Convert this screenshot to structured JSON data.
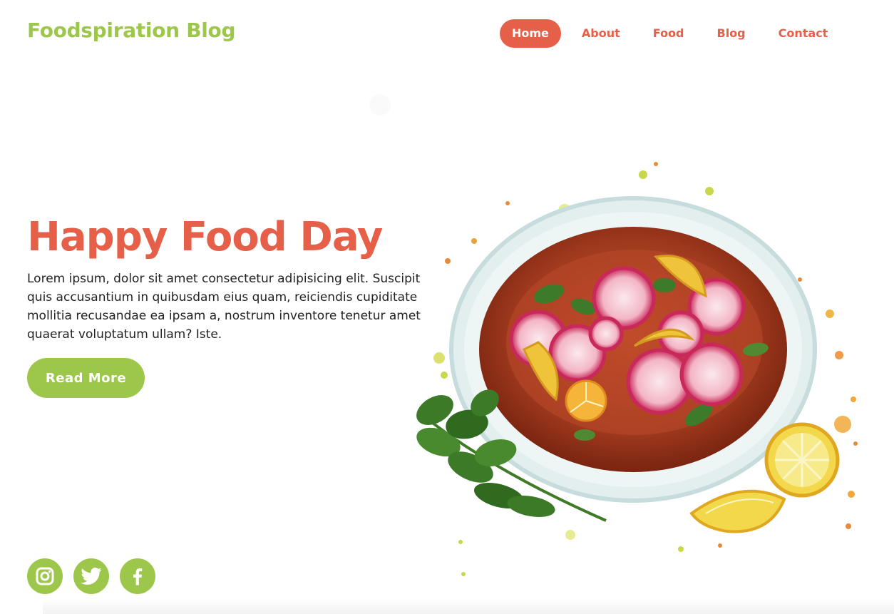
{
  "brand": {
    "name": "Foodspiration Blog"
  },
  "nav": {
    "items": [
      {
        "label": "Home",
        "active": true
      },
      {
        "label": "About",
        "active": false
      },
      {
        "label": "Food",
        "active": false
      },
      {
        "label": "Blog",
        "active": false
      },
      {
        "label": "Contact",
        "active": false
      }
    ]
  },
  "hero": {
    "title": "Happy Food Day",
    "text": "Lorem ipsum, dolor sit amet consectetur adipisicing elit. Suscipit quis accusantium in quibusdam eius quam, reiciendis cupiditate mollitia recusandae ea ipsam a, nostrum inventore tenetur amet quaerat voluptatum ullam? Iste.",
    "button_label": "Read More"
  },
  "social": [
    {
      "icon": "instagram-icon"
    },
    {
      "icon": "twitter-icon"
    },
    {
      "icon": "facebook-icon"
    }
  ],
  "colors": {
    "accent_red": "#e65f48",
    "accent_green": "#9dc74a",
    "text": "#222222",
    "background": "#ffffff"
  }
}
